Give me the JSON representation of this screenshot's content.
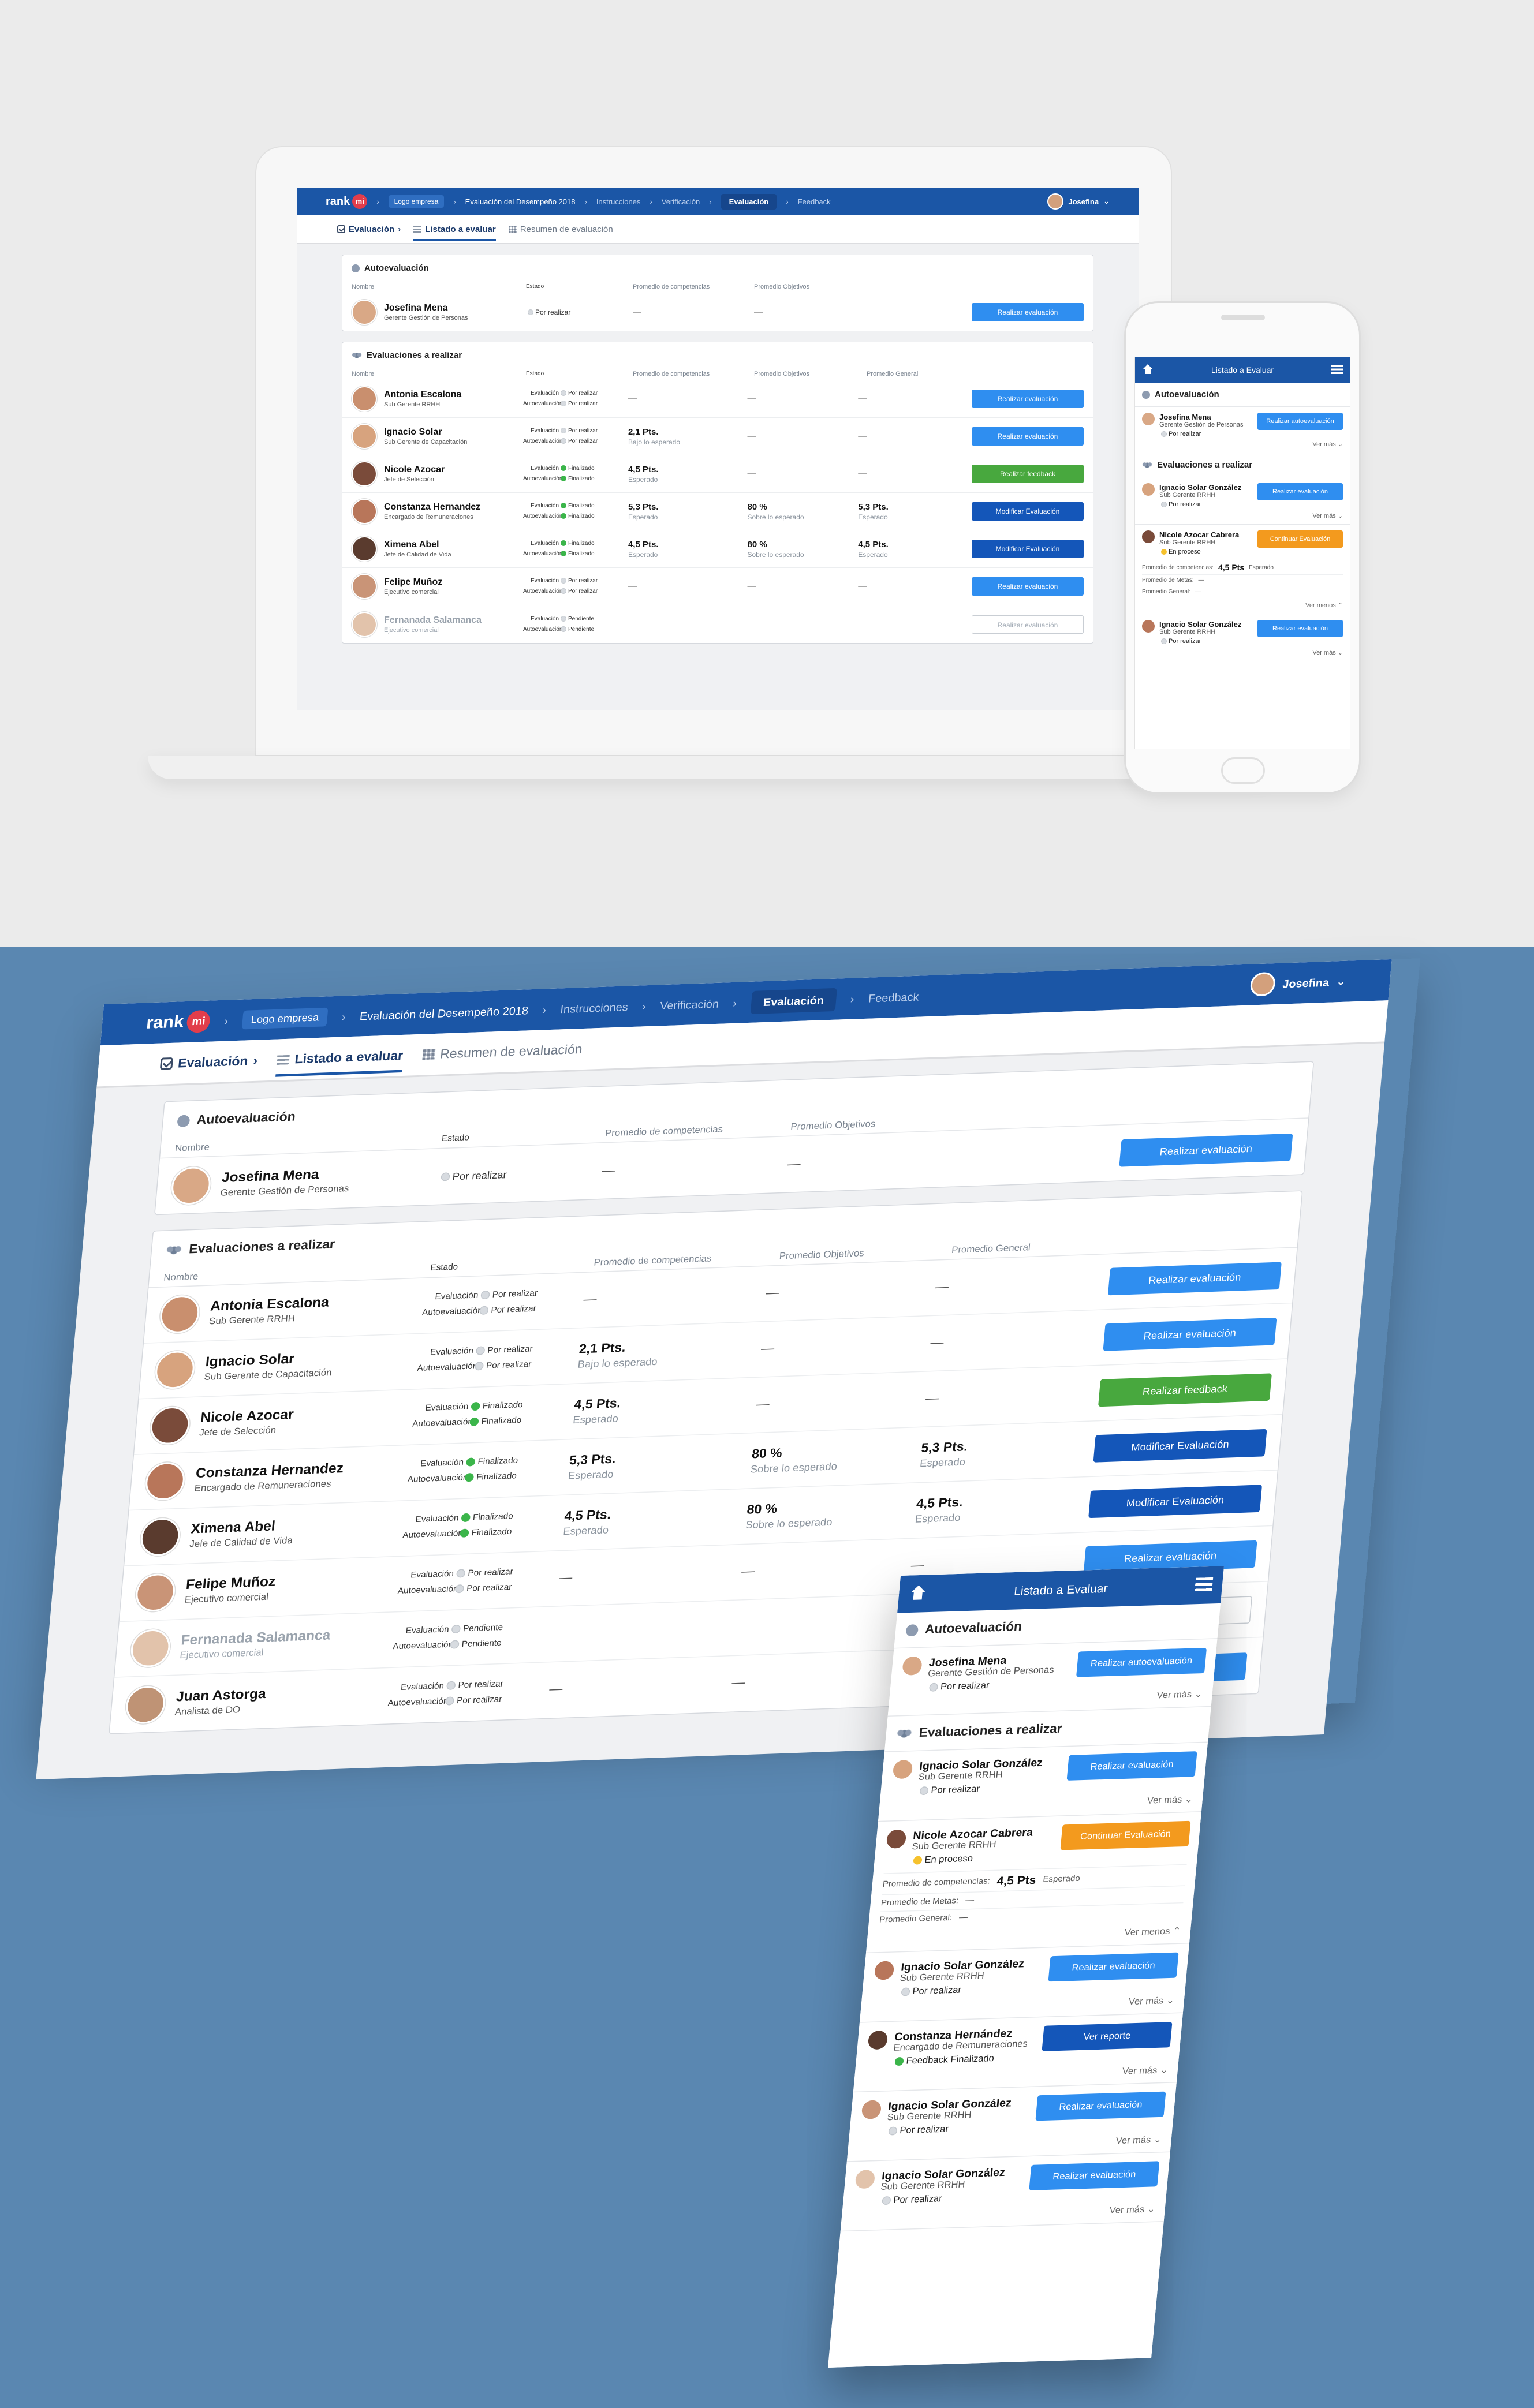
{
  "app": {
    "brand": "rank",
    "brand_mark": "mi",
    "company_chip": "Logo empresa",
    "breadcrumbs": [
      "Evaluación del Desempeño 2018",
      "Instrucciones",
      "Verificación",
      "Evaluación",
      "Feedback"
    ],
    "active_step": "Evaluación",
    "user_name": "Josefina"
  },
  "tabs": {
    "title": "Evaluación",
    "items": [
      "Listado a evaluar",
      "Resumen de evaluación"
    ]
  },
  "self_eval": {
    "title": "Autoevaluación",
    "columns": [
      "Nombre",
      "Estado",
      "Promedio de competencias",
      "Promedio Objetivos"
    ],
    "name": "Josefina Mena",
    "role": "Gerente Gestión de Personas",
    "state": "Por realizar",
    "comp": "—",
    "obj": "—",
    "button": "Realizar evaluación"
  },
  "evals": {
    "title": "Evaluaciones a realizar",
    "columns": [
      "Nombre",
      "Estado",
      "Promedio de competencias",
      "Promedio Objetivos",
      "Promedio General"
    ],
    "state_labels": {
      "eval": "Evaluación",
      "auto": "Autoevaluación"
    },
    "rows": [
      {
        "name": "Antonia Escalona",
        "role": "Sub Gerente RRHH",
        "eval_state": "Por realizar",
        "auto_state": "Por realizar",
        "eval_dot": "gray",
        "auto_dot": "gray",
        "comp": "—",
        "comp_sub": "",
        "obj": "—",
        "obj_sub": "",
        "gen": "—",
        "gen_sub": "",
        "button": "Realizar evaluación",
        "btn": "blue",
        "dim": false
      },
      {
        "name": "Ignacio Solar",
        "role": "Sub Gerente de Capacitación",
        "eval_state": "Por realizar",
        "auto_state": "Por realizar",
        "eval_dot": "gray",
        "auto_dot": "gray",
        "comp": "2,1 Pts.",
        "comp_sub": "Bajo lo esperado",
        "obj": "—",
        "obj_sub": "",
        "gen": "—",
        "gen_sub": "",
        "button": "Realizar evaluación",
        "btn": "blue",
        "dim": false
      },
      {
        "name": "Nicole Azocar",
        "role": "Jefe de Selección",
        "eval_state": "Finalizado",
        "auto_state": "Finalizado",
        "eval_dot": "green",
        "auto_dot": "green",
        "comp": "4,5 Pts.",
        "comp_sub": "Esperado",
        "obj": "—",
        "obj_sub": "",
        "gen": "—",
        "gen_sub": "",
        "button": "Realizar feedback",
        "btn": "green",
        "dim": false
      },
      {
        "name": "Constanza Hernandez",
        "role": "Encargado de Remuneraciones",
        "eval_state": "Finalizado",
        "auto_state": "Finalizado",
        "eval_dot": "green",
        "auto_dot": "green",
        "comp": "5,3 Pts.",
        "comp_sub": "Esperado",
        "obj": "80 %",
        "obj_sub": "Sobre lo esperado",
        "gen": "5,3 Pts.",
        "gen_sub": "Esperado",
        "button": "Modificar Evaluación",
        "btn": "navy",
        "dim": false
      },
      {
        "name": "Ximena Abel",
        "role": "Jefe de Calidad de Vida",
        "eval_state": "Finalizado",
        "auto_state": "Finalizado",
        "eval_dot": "green",
        "auto_dot": "green",
        "comp": "4,5 Pts.",
        "comp_sub": "Esperado",
        "obj": "80 %",
        "obj_sub": "Sobre lo esperado",
        "gen": "4,5 Pts.",
        "gen_sub": "Esperado",
        "button": "Modificar Evaluación",
        "btn": "navy",
        "dim": false
      },
      {
        "name": "Felipe Muñoz",
        "role": "Ejecutivo comercial",
        "eval_state": "Por realizar",
        "auto_state": "Por realizar",
        "eval_dot": "gray",
        "auto_dot": "gray",
        "comp": "—",
        "comp_sub": "",
        "obj": "—",
        "obj_sub": "",
        "gen": "—",
        "gen_sub": "",
        "button": "Realizar evaluación",
        "btn": "blue",
        "dim": false
      },
      {
        "name": "Fernanada Salamanca",
        "role": "Ejecutivo comercial",
        "eval_state": "Pendiente",
        "auto_state": "Pendiente",
        "eval_dot": "gray",
        "auto_dot": "gray",
        "comp": "",
        "comp_sub": "",
        "obj": "",
        "obj_sub": "",
        "gen": "",
        "gen_sub": "",
        "button": "Realizar evaluación",
        "btn": "ghost",
        "dim": true
      },
      {
        "name": "Juan Astorga",
        "role": "Analista de DO",
        "eval_state": "Por realizar",
        "auto_state": "Por realizar",
        "eval_dot": "gray",
        "auto_dot": "gray",
        "comp": "—",
        "comp_sub": "",
        "obj": "—",
        "obj_sub": "",
        "gen": "—",
        "gen_sub": "",
        "button": "Realizar evaluación",
        "btn": "blue",
        "dim": false
      }
    ]
  },
  "mobile": {
    "header": "Listado a Evaluar",
    "self_title": "Autoevaluación",
    "self": {
      "name": "Josefina Mena",
      "role": "Gerente Gestión de Personas",
      "state": "Por realizar",
      "button": "Realizar autoevaluación",
      "more": "Ver más"
    },
    "evals_title": "Evaluaciones a realizar",
    "detail_labels": {
      "comp": "Promedio de competencias:",
      "metas": "Promedio de Metas:",
      "gen": "Promedio General:"
    },
    "detail_value": "4,5 Pts",
    "detail_sub": "Esperado",
    "rows": [
      {
        "name": "Ignacio Solar González",
        "role": "Sub Gerente RRHH",
        "state": "Por realizar",
        "dot": "gray",
        "button": "Realizar evaluación",
        "btn": "blue",
        "more": "Ver más",
        "expanded": false
      },
      {
        "name": "Nicole Azocar Cabrera",
        "role": "Sub Gerente RRHH",
        "state": "En proceso",
        "dot": "yellow",
        "button": "Continuar Evaluación",
        "btn": "orange",
        "more": "Ver menos",
        "expanded": true
      },
      {
        "name": "Ignacio Solar González",
        "role": "Sub Gerente RRHH",
        "state": "Por realizar",
        "dot": "gray",
        "button": "Realizar evaluación",
        "btn": "blue",
        "more": "Ver más",
        "expanded": false
      },
      {
        "name": "Constanza Hernández",
        "role": "Encargado de Remuneraciones",
        "state": "Feedback Finalizado",
        "dot": "green",
        "button": "Ver reporte",
        "btn": "navy",
        "more": "Ver más",
        "expanded": false
      },
      {
        "name": "Ignacio Solar González",
        "role": "Sub Gerente RRHH",
        "state": "Por realizar",
        "dot": "gray",
        "button": "Realizar evaluación",
        "btn": "blue",
        "more": "Ver más",
        "expanded": false
      },
      {
        "name": "Ignacio Solar González",
        "role": "Sub Gerente RRHH",
        "state": "Por realizar",
        "dot": "gray",
        "button": "Realizar evaluación",
        "btn": "blue",
        "more": "Ver más",
        "expanded": false
      }
    ]
  },
  "colors": {
    "primary": "#1b56a6",
    "button_blue": "#2f8ef0",
    "button_green": "#48a83e",
    "button_navy": "#1456b9",
    "button_orange": "#f39a1e",
    "background_bottom": "#5a87b1",
    "background_top": "#ebebeb"
  }
}
